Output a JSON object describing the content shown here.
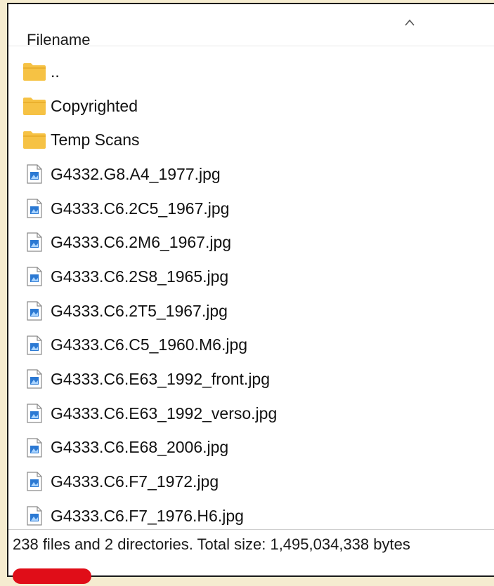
{
  "header": {
    "column_label": "Filename"
  },
  "folders": [
    {
      "name": "..",
      "icon": "folder-icon"
    },
    {
      "name": "Copyrighted",
      "icon": "folder-icon"
    },
    {
      "name": "Temp Scans",
      "icon": "folder-icon"
    }
  ],
  "files": [
    {
      "name": "G4332.G8.A4_1977.jpg",
      "icon": "image-file-icon"
    },
    {
      "name": "G4333.C6.2C5_1967.jpg",
      "icon": "image-file-icon"
    },
    {
      "name": "G4333.C6.2M6_1967.jpg",
      "icon": "image-file-icon"
    },
    {
      "name": "G4333.C6.2S8_1965.jpg",
      "icon": "image-file-icon"
    },
    {
      "name": "G4333.C6.2T5_1967.jpg",
      "icon": "image-file-icon"
    },
    {
      "name": "G4333.C6.C5_1960.M6.jpg",
      "icon": "image-file-icon"
    },
    {
      "name": "G4333.C6.E63_1992_front.jpg",
      "icon": "image-file-icon"
    },
    {
      "name": "G4333.C6.E63_1992_verso.jpg",
      "icon": "image-file-icon"
    },
    {
      "name": "G4333.C6.E68_2006.jpg",
      "icon": "image-file-icon"
    },
    {
      "name": "G4333.C6.F7_1972.jpg",
      "icon": "image-file-icon"
    },
    {
      "name": "G4333.C6.F7_1976.H6.jpg",
      "icon": "image-file-icon"
    }
  ],
  "status": {
    "text": "238 files and 2 directories. Total size: 1,495,034,338 bytes"
  },
  "colors": {
    "folder": "#f6c244",
    "folder_dark": "#e4a520",
    "file_accent": "#2b79d3",
    "highlight_mark": "#e00d18",
    "page_background": "#f5ecd0"
  }
}
